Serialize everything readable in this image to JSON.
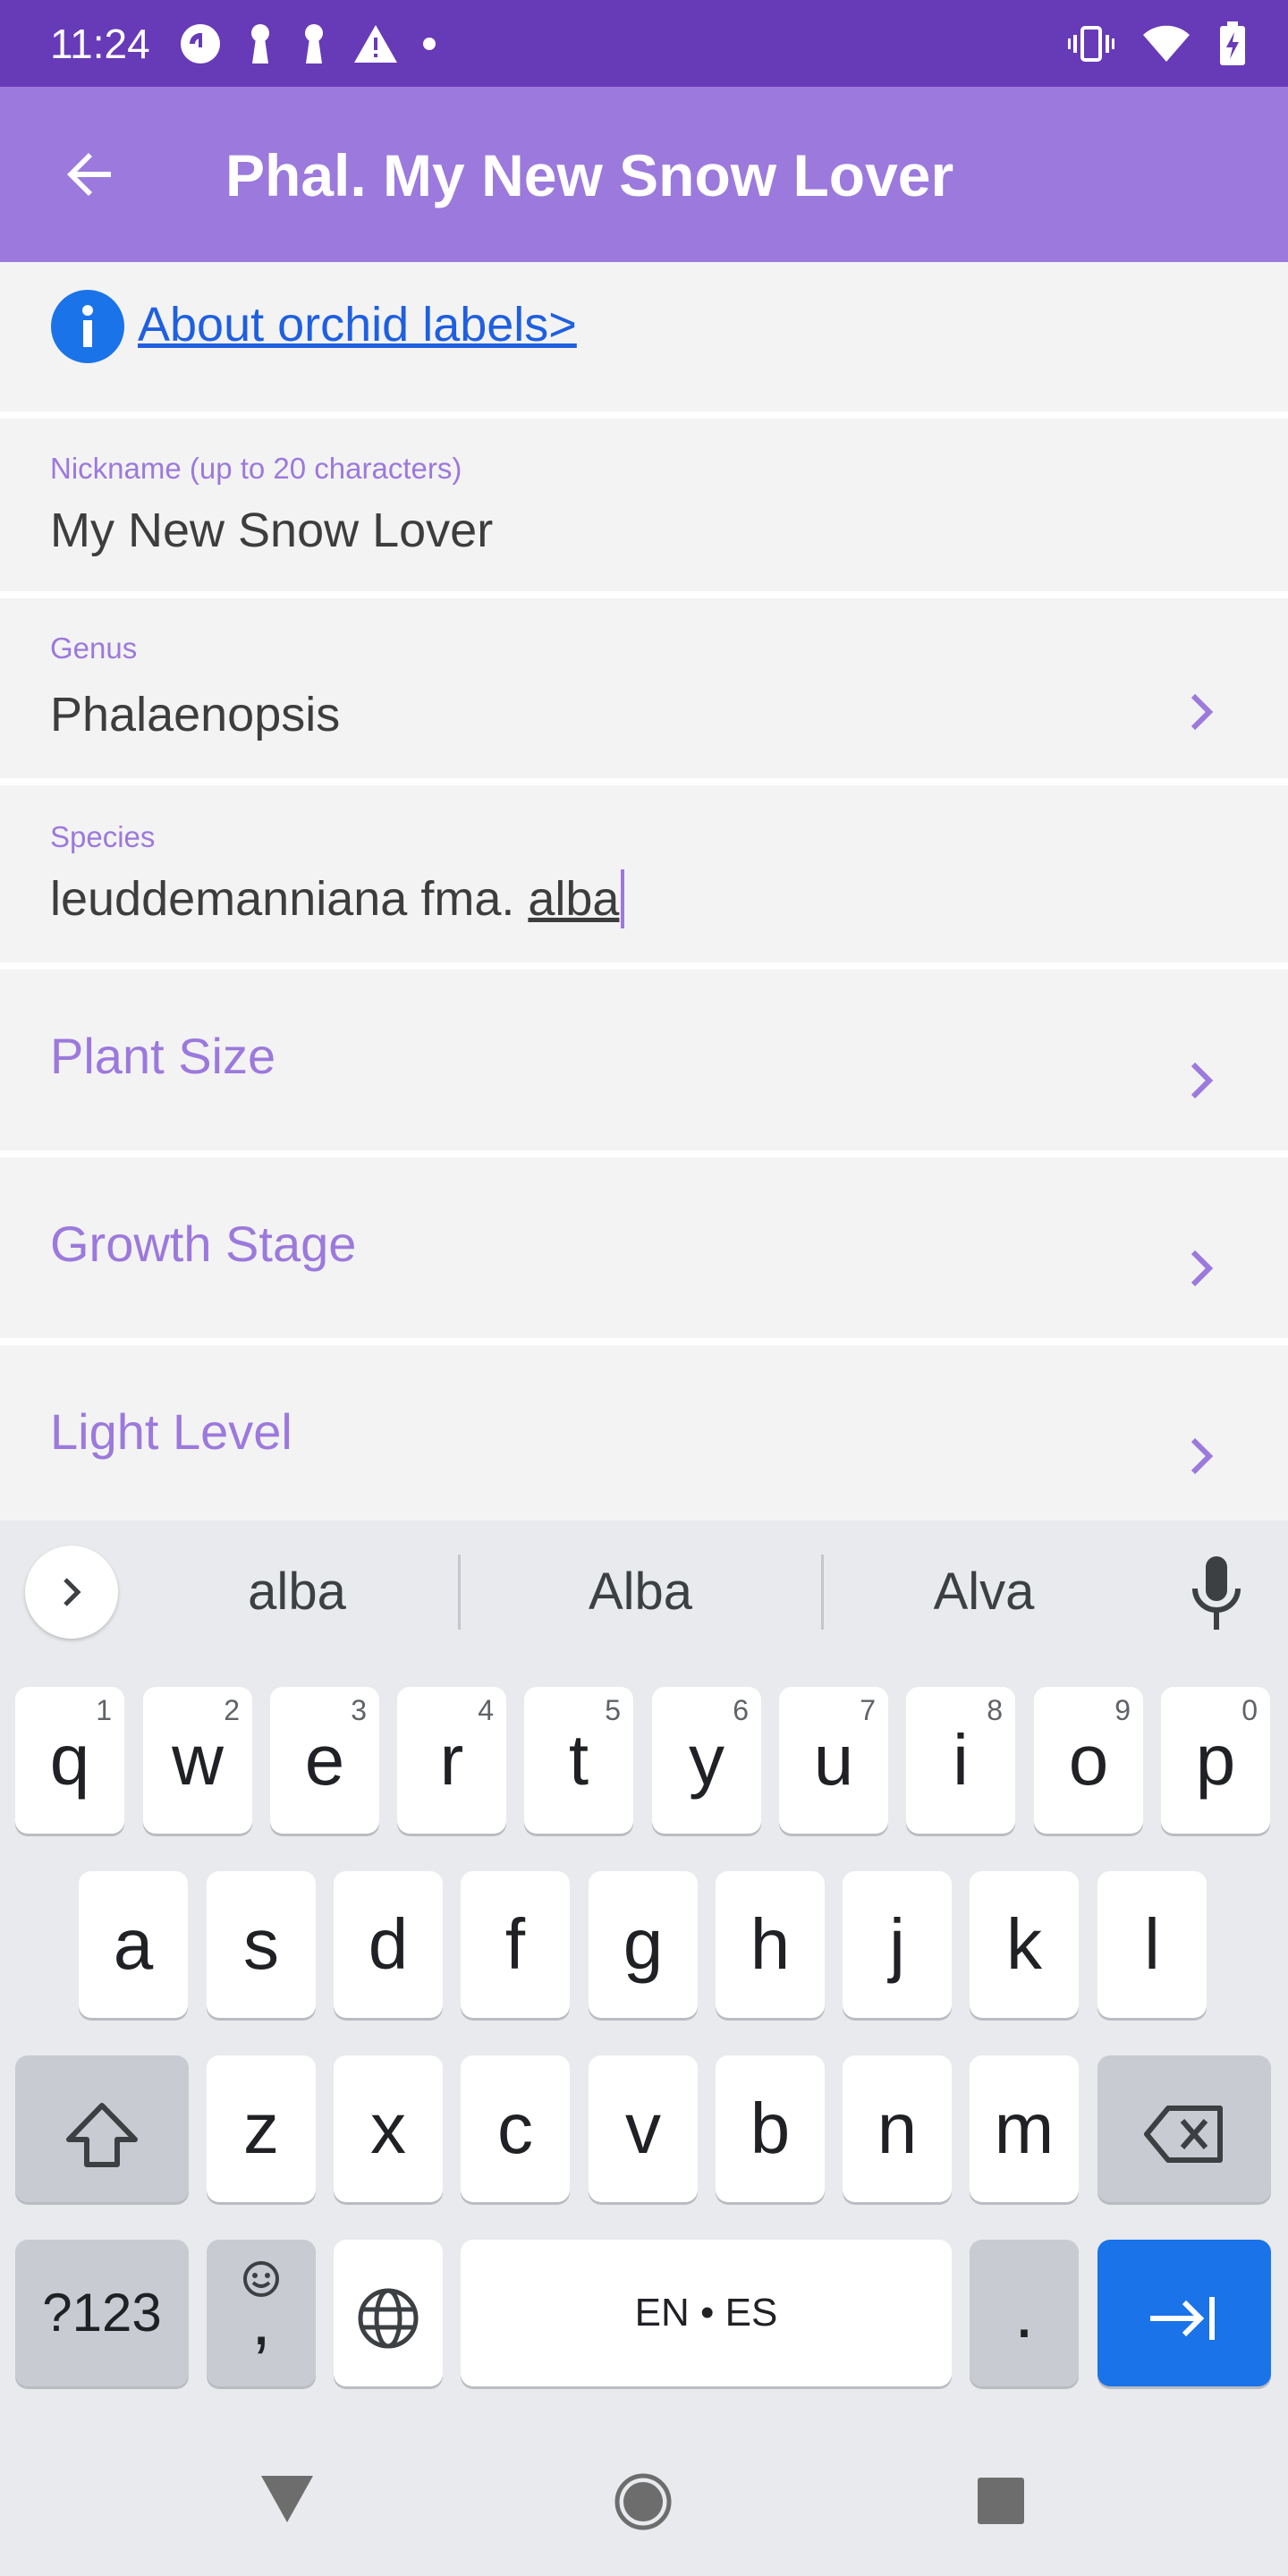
{
  "status_bar": {
    "time": "11:24",
    "left_icons": [
      "pocket-casts-icon",
      "keyhole-icon",
      "keyhole-icon",
      "warning-icon",
      "dot-icon"
    ],
    "right_icons": [
      "vibrate-icon",
      "wifi-icon",
      "battery-charging-icon"
    ]
  },
  "app_bar": {
    "back_icon": "arrow-back-icon",
    "title": "Phal. My New Snow Lover"
  },
  "info": {
    "icon": "info-icon",
    "link_text": "About orchid labels>"
  },
  "form": {
    "nickname": {
      "label": "Nickname (up to 20 characters)",
      "value": "My New Snow Lover"
    },
    "genus": {
      "label": "Genus",
      "value": "Phalaenopsis"
    },
    "species": {
      "label": "Species",
      "value_prefix": "leuddemanniana fma. ",
      "value_composing": "alba"
    },
    "sections": [
      {
        "label": "Plant Size"
      },
      {
        "label": "Growth Stage"
      },
      {
        "label": "Light Level"
      }
    ],
    "accent_color": "#9c79dc"
  },
  "keyboard": {
    "suggestions": [
      "alba",
      "Alba",
      "Alva"
    ],
    "row1": [
      {
        "k": "q",
        "h": "1"
      },
      {
        "k": "w",
        "h": "2"
      },
      {
        "k": "e",
        "h": "3"
      },
      {
        "k": "r",
        "h": "4"
      },
      {
        "k": "t",
        "h": "5"
      },
      {
        "k": "y",
        "h": "6"
      },
      {
        "k": "u",
        "h": "7"
      },
      {
        "k": "i",
        "h": "8"
      },
      {
        "k": "o",
        "h": "9"
      },
      {
        "k": "p",
        "h": "0"
      }
    ],
    "row2": [
      "a",
      "s",
      "d",
      "f",
      "g",
      "h",
      "j",
      "k",
      "l"
    ],
    "row3": [
      "z",
      "x",
      "c",
      "v",
      "b",
      "n",
      "m"
    ],
    "symbols_label": "?123",
    "comma_label": ",",
    "space_label": "EN • ES",
    "period_label": ".",
    "enter_color": "#1a73e8"
  },
  "nav_bar": {
    "icons": [
      "back-triangle-icon",
      "home-circle-icon",
      "recents-square-icon"
    ]
  }
}
